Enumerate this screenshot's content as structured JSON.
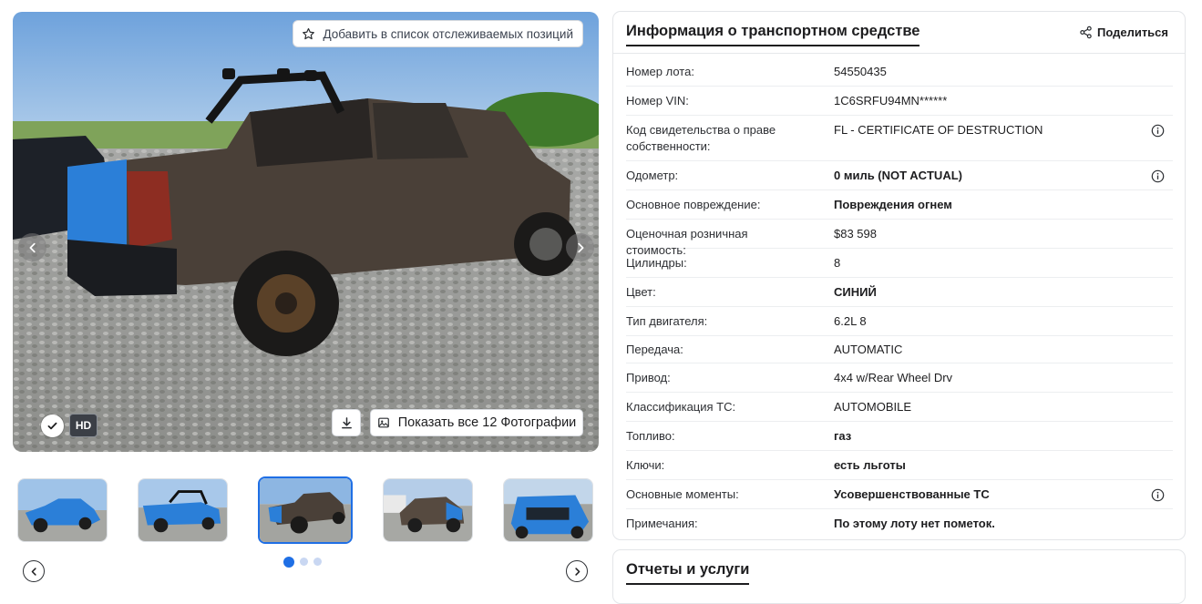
{
  "gallery": {
    "watchlist_label": "Добавить в список отслеживаемых позиций",
    "hd_label": "HD",
    "show_all_label": "Показать все 12 Фотографии",
    "dots": 3,
    "active_dot": 0
  },
  "info": {
    "title": "Информация о транспортном средстве",
    "share_label": "Поделиться",
    "rows": [
      {
        "label": "Номер лота:",
        "value": "54550435",
        "bold": false,
        "info": false
      },
      {
        "label": "Номер VIN:",
        "value": "1C6SRFU94MN******",
        "bold": false,
        "info": false
      },
      {
        "label": "Код свидетельства о праве собственности:",
        "value": "FL - CERTIFICATE OF DESTRUCTION",
        "bold": false,
        "info": true
      },
      {
        "label": "Одометр:",
        "value": "0 миль (NOT ACTUAL)",
        "bold": true,
        "info": true
      },
      {
        "label": "Основное повреждение:",
        "value": "Повреждения огнем",
        "bold": true,
        "info": false
      },
      {
        "label": "Оценочная розничная стоимость:",
        "value": "$83 598",
        "bold": false,
        "info": false
      },
      {
        "label": "Цилиндры:",
        "value": "8",
        "bold": false,
        "info": false
      },
      {
        "label": "Цвет:",
        "value": "СИНИЙ",
        "bold": true,
        "info": false
      },
      {
        "label": "Тип двигателя:",
        "value": "6.2L 8",
        "bold": false,
        "info": false
      },
      {
        "label": "Передача:",
        "value": "AUTOMATIC",
        "bold": false,
        "info": false
      },
      {
        "label": "Привод:",
        "value": "4x4 w/Rear Wheel Drv",
        "bold": false,
        "info": false
      },
      {
        "label": "Классификация ТС:",
        "value": "AUTOMOBILE",
        "bold": false,
        "info": false
      },
      {
        "label": "Топливо:",
        "value": "газ",
        "bold": true,
        "info": false
      },
      {
        "label": "Ключи:",
        "value": "есть льготы",
        "bold": true,
        "info": false
      },
      {
        "label": "Основные моменты:",
        "value": "Усовершенствованные ТС",
        "bold": true,
        "info": true
      },
      {
        "label": "Примечания:",
        "value": "По этому лоту нет пометок.",
        "bold": true,
        "info": false
      }
    ]
  },
  "reports": {
    "title": "Отчеты и услуги"
  },
  "icons": {
    "watch": "star-icon",
    "prev": "chevron-left-icon",
    "next": "chevron-right-icon",
    "check": "check-icon",
    "download": "download-icon",
    "photos": "image-icon",
    "share": "share-icon",
    "info": "info-icon"
  },
  "colors": {
    "accent": "#1f6fe5",
    "truck_blue": "#2b7fd8"
  }
}
